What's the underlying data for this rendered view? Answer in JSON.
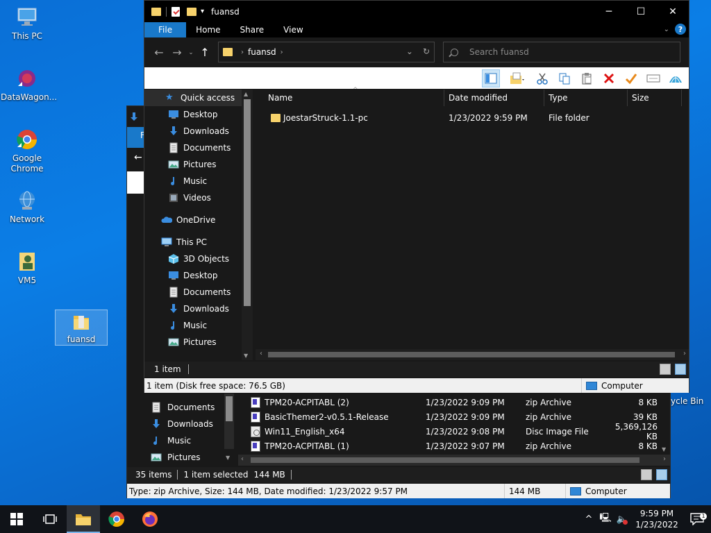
{
  "desktop": {
    "icons": [
      {
        "label": "This PC"
      },
      {
        "label": "DataWagon..."
      },
      {
        "label": "Google Chrome"
      },
      {
        "label": "Network"
      },
      {
        "label": "VM5"
      },
      {
        "label": "fuansd"
      }
    ],
    "recycle_bin_partial": "ycle Bin"
  },
  "back_window": {
    "tab_partial": "F",
    "nav_items": [
      {
        "label": "Documents",
        "icon": "documents-icon"
      },
      {
        "label": "Downloads",
        "icon": "downloads-icon"
      },
      {
        "label": "Music",
        "icon": "music-icon"
      },
      {
        "label": "Pictures",
        "icon": "pictures-icon"
      }
    ],
    "files": [
      {
        "name": "TPM20-ACPITABL (2)",
        "date": "1/23/2022 9:09 PM",
        "type": "zip Archive",
        "size": "8 KB",
        "icon": "zip-icon"
      },
      {
        "name": "BasicThemer2-v0.5.1-Release",
        "date": "1/23/2022 9:09 PM",
        "type": "zip Archive",
        "size": "39 KB",
        "icon": "zip-icon"
      },
      {
        "name": "Win11_English_x64",
        "date": "1/23/2022 9:08 PM",
        "type": "Disc Image File",
        "size": "5,369,126 KB",
        "icon": "disc-image-icon"
      },
      {
        "name": "TPM20-ACPITABL (1)",
        "date": "1/23/2022 9:07 PM",
        "type": "zip Archive",
        "size": "8 KB",
        "icon": "zip-icon"
      }
    ],
    "status": {
      "count": "35 items",
      "selected": "1 item selected",
      "size": "144 MB"
    },
    "info": {
      "details": "Type: zip Archive, Size: 144 MB, Date modified: 1/23/2022 9:57 PM",
      "size": "144 MB",
      "location": "Computer"
    }
  },
  "window": {
    "title": "fuansd",
    "controls": {
      "minimize": "─",
      "maximize": "☐",
      "close": "✕"
    },
    "ribbon_tabs": [
      "File",
      "Home",
      "Share",
      "View"
    ],
    "address": {
      "crumb": "fuansd"
    },
    "search": {
      "placeholder": "Search fuansd"
    },
    "nav": {
      "quick_access": "Quick access",
      "quick_items": [
        {
          "label": "Desktop",
          "icon": "desktop-icon",
          "pinned": true
        },
        {
          "label": "Downloads",
          "icon": "downloads-icon",
          "pinned": true
        },
        {
          "label": "Documents",
          "icon": "documents-icon",
          "pinned": true
        },
        {
          "label": "Pictures",
          "icon": "pictures-icon",
          "pinned": true
        },
        {
          "label": "Music",
          "icon": "music-icon",
          "pinned": false
        },
        {
          "label": "Videos",
          "icon": "videos-icon",
          "pinned": false
        }
      ],
      "onedrive": "OneDrive",
      "this_pc": "This PC",
      "pc_items": [
        {
          "label": "3D Objects",
          "icon": "3d-objects-icon"
        },
        {
          "label": "Desktop",
          "icon": "desktop-icon"
        },
        {
          "label": "Documents",
          "icon": "documents-icon"
        },
        {
          "label": "Downloads",
          "icon": "downloads-icon"
        },
        {
          "label": "Music",
          "icon": "music-icon"
        },
        {
          "label": "Pictures",
          "icon": "pictures-icon"
        }
      ]
    },
    "columns": {
      "name": "Name",
      "date": "Date modified",
      "type": "Type",
      "size": "Size"
    },
    "files": [
      {
        "name": "JoestarStruck-1.1-pc",
        "date": "1/23/2022 9:59 PM",
        "type": "File folder",
        "size": ""
      }
    ],
    "status": {
      "count": "1 item"
    },
    "info": {
      "details": "1 item (Disk free space: 76.5 GB)",
      "location": "Computer"
    }
  },
  "taskbar": {
    "time": "9:59 PM",
    "date": "1/23/2022"
  },
  "colors": {
    "accent": "#1979ca",
    "folder": "#f7d26b",
    "taskbar": "#101318"
  }
}
